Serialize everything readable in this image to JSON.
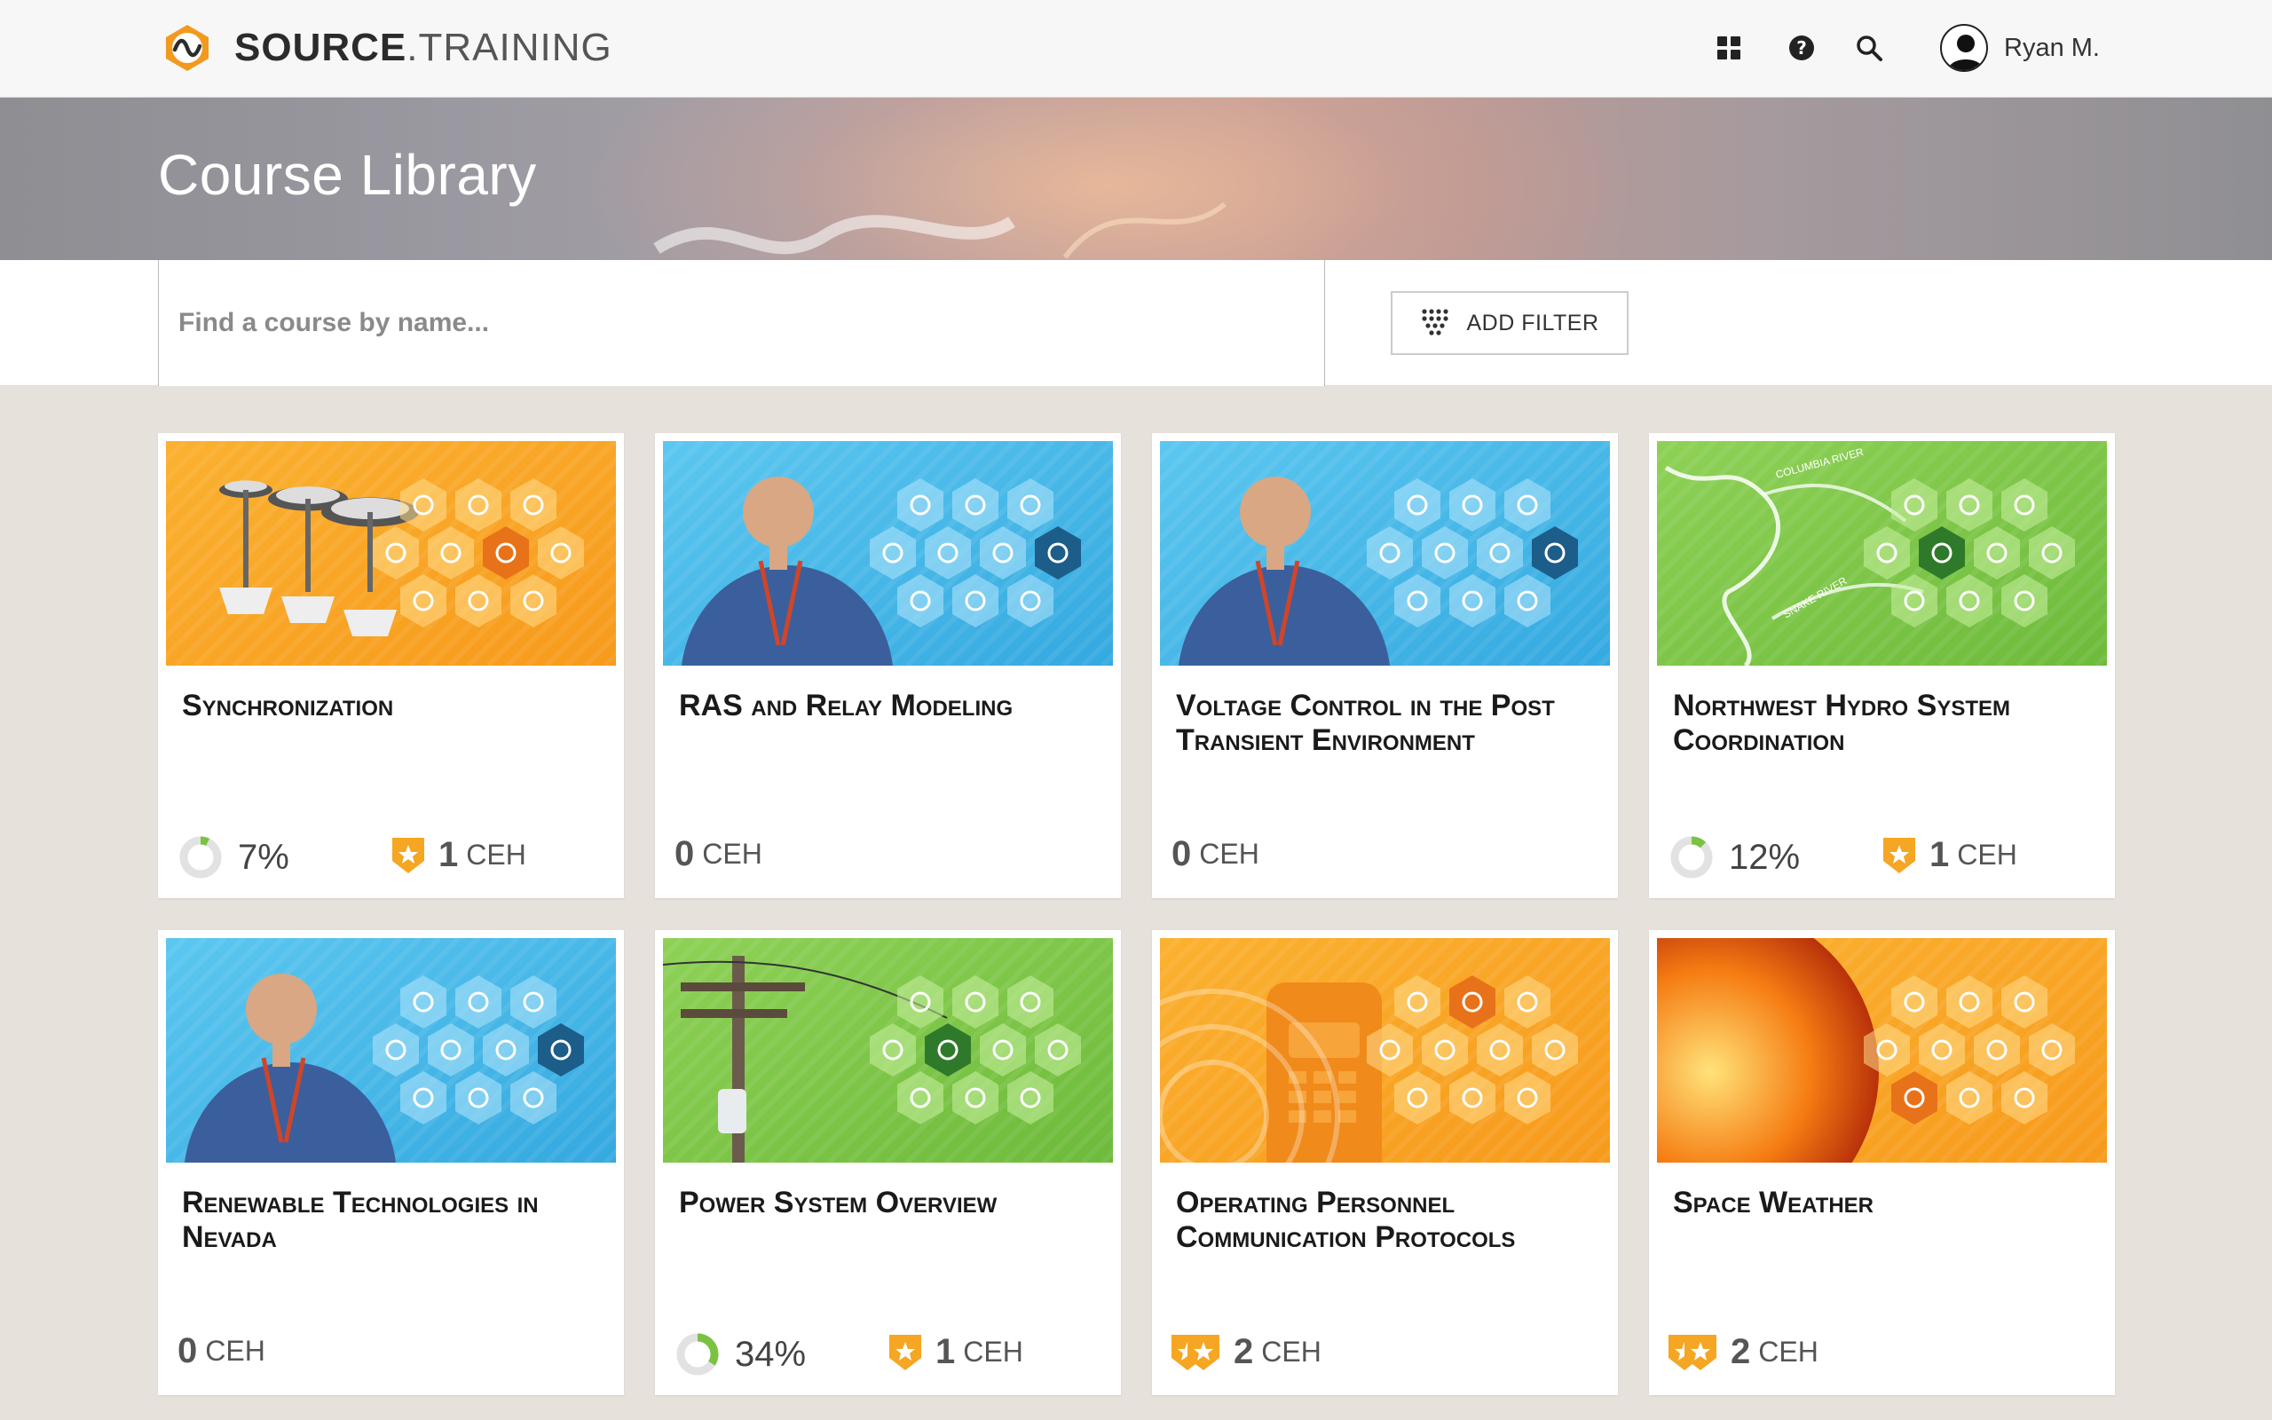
{
  "app": {
    "brand_bold": "SOURCE",
    "brand_light": ".TRAINING",
    "user_name": "Ryan M."
  },
  "nav_icons": [
    "grid-icon",
    "help-icon",
    "search-icon",
    "user-icon"
  ],
  "hero": {
    "title": "Course Library"
  },
  "search": {
    "placeholder": "Find a course by name..."
  },
  "filter": {
    "label": "ADD FILTER"
  },
  "colors": {
    "orange": "#f5a623",
    "blue": "#46b7e8",
    "green": "#78c445",
    "badge": "#f5a623"
  },
  "courses": [
    {
      "title": "Synchronization",
      "theme": "orange",
      "progress": "7%",
      "progress_value": 0.07,
      "ceh_num": "1",
      "ceh_unit": "CEH",
      "badges": 1
    },
    {
      "title": "RAS and Relay Modeling",
      "theme": "blue",
      "progress": "",
      "progress_value": null,
      "ceh_num": "0",
      "ceh_unit": "CEH",
      "badges": 0
    },
    {
      "title": "Voltage Control in the Post Transient Environment",
      "theme": "blue",
      "progress": "",
      "progress_value": null,
      "ceh_num": "0",
      "ceh_unit": "CEH",
      "badges": 0
    },
    {
      "title": "Northwest Hydro System Coordination",
      "theme": "green",
      "progress": "12%",
      "progress_value": 0.12,
      "ceh_num": "1",
      "ceh_unit": "CEH",
      "badges": 1,
      "map_labels": [
        "COLUMBIA RIVER",
        "SNAKE RIVER"
      ]
    },
    {
      "title": "Renewable Technologies in Nevada",
      "theme": "blue",
      "progress": "",
      "progress_value": null,
      "ceh_num": "0",
      "ceh_unit": "CEH",
      "badges": 0
    },
    {
      "title": "Power System Overview",
      "theme": "green",
      "progress": "34%",
      "progress_value": 0.34,
      "ceh_num": "1",
      "ceh_unit": "CEH",
      "badges": 1
    },
    {
      "title": "Operating Personnel Communication Protocols",
      "theme": "orange",
      "progress": "",
      "progress_value": null,
      "ceh_num": "2",
      "ceh_unit": "CEH",
      "badges": 2
    },
    {
      "title": "Space Weather",
      "theme": "orange",
      "progress": "",
      "progress_value": null,
      "ceh_num": "2",
      "ceh_unit": "CEH",
      "badges": 2
    }
  ]
}
